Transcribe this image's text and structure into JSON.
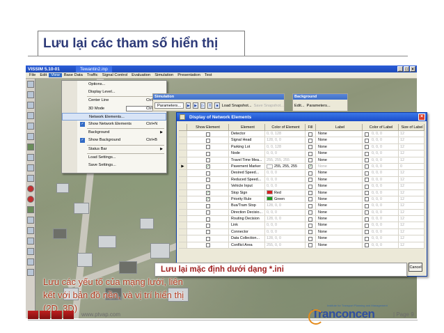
{
  "slide": {
    "title": "Lưu lại các tham số hiển thị",
    "note": "Lưu lại mặc định dưới dạng *.ini",
    "caption_lines": [
      "Lưu các yếu tố của mạng lưới, liên",
      "kết với bản đồ nền, và vị trí hiển thị",
      "(2D, 3D)"
    ]
  },
  "window": {
    "title": "VISSIM 5.10-01",
    "doc_tab": "Tewantin2.inp",
    "controls": [
      "_",
      "□",
      "×"
    ]
  },
  "menubar": [
    "File",
    "Edit",
    "View",
    "Base Data",
    "Traffic",
    "Signal Control",
    "Evaluation",
    "Simulation",
    "Presentation",
    "Test"
  ],
  "view_menu": {
    "items": [
      {
        "label": "Options...",
        "shortcut": "",
        "checked": false
      },
      {
        "label": "Display Level...",
        "shortcut": "",
        "checked": false
      },
      {
        "label": "Center Line",
        "shortcut": "Ctrl+A",
        "checked": false
      },
      {
        "label": "3D Mode",
        "shortcut": "Ctrl+D",
        "checked": false
      },
      {
        "label": "Network Elements...",
        "shortcut": "",
        "checked": false
      },
      {
        "label": "Show Network Elements",
        "shortcut": "Ctrl+N",
        "checked": true
      },
      {
        "label": "Background",
        "shortcut": "",
        "checked": false
      },
      {
        "label": "Show Background",
        "shortcut": "Ctrl+B",
        "checked": true
      },
      {
        "label": "Status Bar",
        "shortcut": "",
        "checked": false
      },
      {
        "label": "Load Settings...",
        "shortcut": "",
        "checked": false
      },
      {
        "label": "Save Settings...",
        "shortcut": "",
        "checked": false
      }
    ]
  },
  "simulation_bar": {
    "caption": "Simulation",
    "params_label": "Parameters...",
    "load_snapshot": "Load Snapshot...",
    "save_snapshot": "Save Snapshot..."
  },
  "background_bar": {
    "caption": "Background",
    "edit_label": "Edit...",
    "params_label": "Parameters..."
  },
  "dialog": {
    "title": "Display of Network Elements",
    "columns": [
      "Show Element",
      "Element",
      "Color of Element",
      "Fill",
      "Label",
      "Color of Label",
      "Size of Label"
    ],
    "cancel_label": "Cancel",
    "rows": [
      {
        "show": false,
        "name": "Detector",
        "color": "0, 0, 128",
        "swatch": "",
        "fill": false,
        "label": "None",
        "lcolor": "0, 0, 0",
        "size": "12",
        "active": false
      },
      {
        "show": false,
        "name": "Signal Head",
        "color": "128, 0, 0",
        "swatch": "",
        "fill": false,
        "label": "None",
        "lcolor": "0, 0, 0",
        "size": "12",
        "active": false
      },
      {
        "show": false,
        "name": "Parking Lot",
        "color": "0, 0, 128",
        "swatch": "",
        "fill": false,
        "label": "None",
        "lcolor": "0, 0, 0",
        "size": "12",
        "active": false
      },
      {
        "show": false,
        "name": "Node",
        "color": "0, 0, 0",
        "swatch": "",
        "fill": false,
        "label": "None",
        "lcolor": "0, 0, 0",
        "size": "12",
        "active": false
      },
      {
        "show": false,
        "name": "Travel Time Mea...",
        "color": "255, 255, 255",
        "swatch": "",
        "fill": false,
        "label": "None",
        "lcolor": "0, 0, 0",
        "size": "12",
        "active": false
      },
      {
        "show": true,
        "name": "Pavement Marker",
        "color": "255, 255, 255",
        "swatch": "#ffffff",
        "fill": true,
        "label": "None",
        "lcolor": "0, 0, 0",
        "size": "0",
        "active": true
      },
      {
        "show": false,
        "name": "Desired Speed...",
        "color": "0, 0, 0",
        "swatch": "",
        "fill": false,
        "label": "None",
        "lcolor": "0, 0, 0",
        "size": "12",
        "active": false
      },
      {
        "show": false,
        "name": "Reduced Speed...",
        "color": "0, 0, 0",
        "swatch": "",
        "fill": false,
        "label": "None",
        "lcolor": "0, 0, 0",
        "size": "12",
        "active": false
      },
      {
        "show": false,
        "name": "Vehicle Input",
        "color": "0, 0, 0",
        "swatch": "",
        "fill": false,
        "label": "None",
        "lcolor": "0, 0, 0",
        "size": "12",
        "active": false
      },
      {
        "show": true,
        "name": "Stop Sign",
        "color": "Red",
        "swatch": "#d42020",
        "fill": false,
        "label": "None",
        "lcolor": "0, 0, 0",
        "size": "12",
        "active": true
      },
      {
        "show": true,
        "name": "Priority Rule",
        "color": "Green",
        "swatch": "#1b9a1b",
        "fill": false,
        "label": "None",
        "lcolor": "0, 0, 0",
        "size": "12",
        "active": true
      },
      {
        "show": false,
        "name": "Bus/Tram Stop",
        "color": "128, 0, 0",
        "swatch": "",
        "fill": false,
        "label": "None",
        "lcolor": "0, 0, 0",
        "size": "12",
        "active": false
      },
      {
        "show": false,
        "name": "Direction Decisio...",
        "color": "0, 0, 0",
        "swatch": "",
        "fill": false,
        "label": "None",
        "lcolor": "0, 0, 0",
        "size": "12",
        "active": false
      },
      {
        "show": false,
        "name": "Routing Decision",
        "color": "128, 0, 0",
        "swatch": "",
        "fill": false,
        "label": "None",
        "lcolor": "0, 0, 0",
        "size": "12",
        "active": false
      },
      {
        "show": false,
        "name": "Link",
        "color": "0, 0, 0",
        "swatch": "",
        "fill": false,
        "label": "None",
        "lcolor": "0, 0, 0",
        "size": "12",
        "active": false
      },
      {
        "show": false,
        "name": "Connector",
        "color": "0, 0, 0",
        "swatch": "",
        "fill": false,
        "label": "None",
        "lcolor": "0, 0, 0",
        "size": "12",
        "active": false
      },
      {
        "show": false,
        "name": "Data Collection...",
        "color": "128, 0, 0",
        "swatch": "",
        "fill": false,
        "label": "None",
        "lcolor": "0, 0, 0",
        "size": "12",
        "active": false
      },
      {
        "show": false,
        "name": "Conflict Area",
        "color": "255, 0, 0",
        "swatch": "",
        "fill": false,
        "label": "None",
        "lcolor": "0, 0, 0",
        "size": "12",
        "active": false
      }
    ]
  },
  "footer": {
    "url": "www.ptvap.com",
    "brand_tagline": "Institute for Transport Planning and Management",
    "brand_name": "Tranconcen",
    "page_label": "Page 9"
  }
}
